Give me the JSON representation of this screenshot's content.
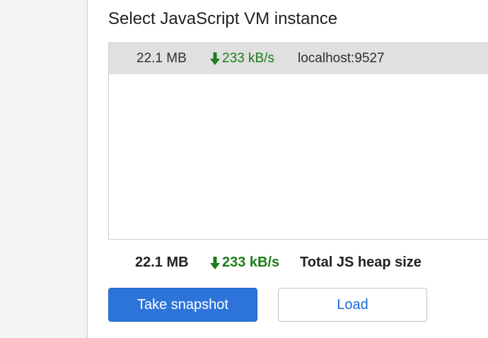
{
  "heading": "Select JavaScript VM instance",
  "vm_list": {
    "items": [
      {
        "size": "22.1 MB",
        "rate": "233 kB/s",
        "host": "localhost:9527",
        "selected": true
      }
    ]
  },
  "summary": {
    "size": "22.1 MB",
    "rate": "233 kB/s",
    "label": "Total JS heap size"
  },
  "buttons": {
    "take_snapshot": "Take snapshot",
    "load": "Load"
  },
  "icons": {
    "rate_arrow": "arrow-down-icon"
  },
  "colors": {
    "primary_button": "#2d74da",
    "rate_green": "#1b7d1b",
    "selected_row": "#e0e0e0",
    "link_blue": "#1a6ad6"
  }
}
